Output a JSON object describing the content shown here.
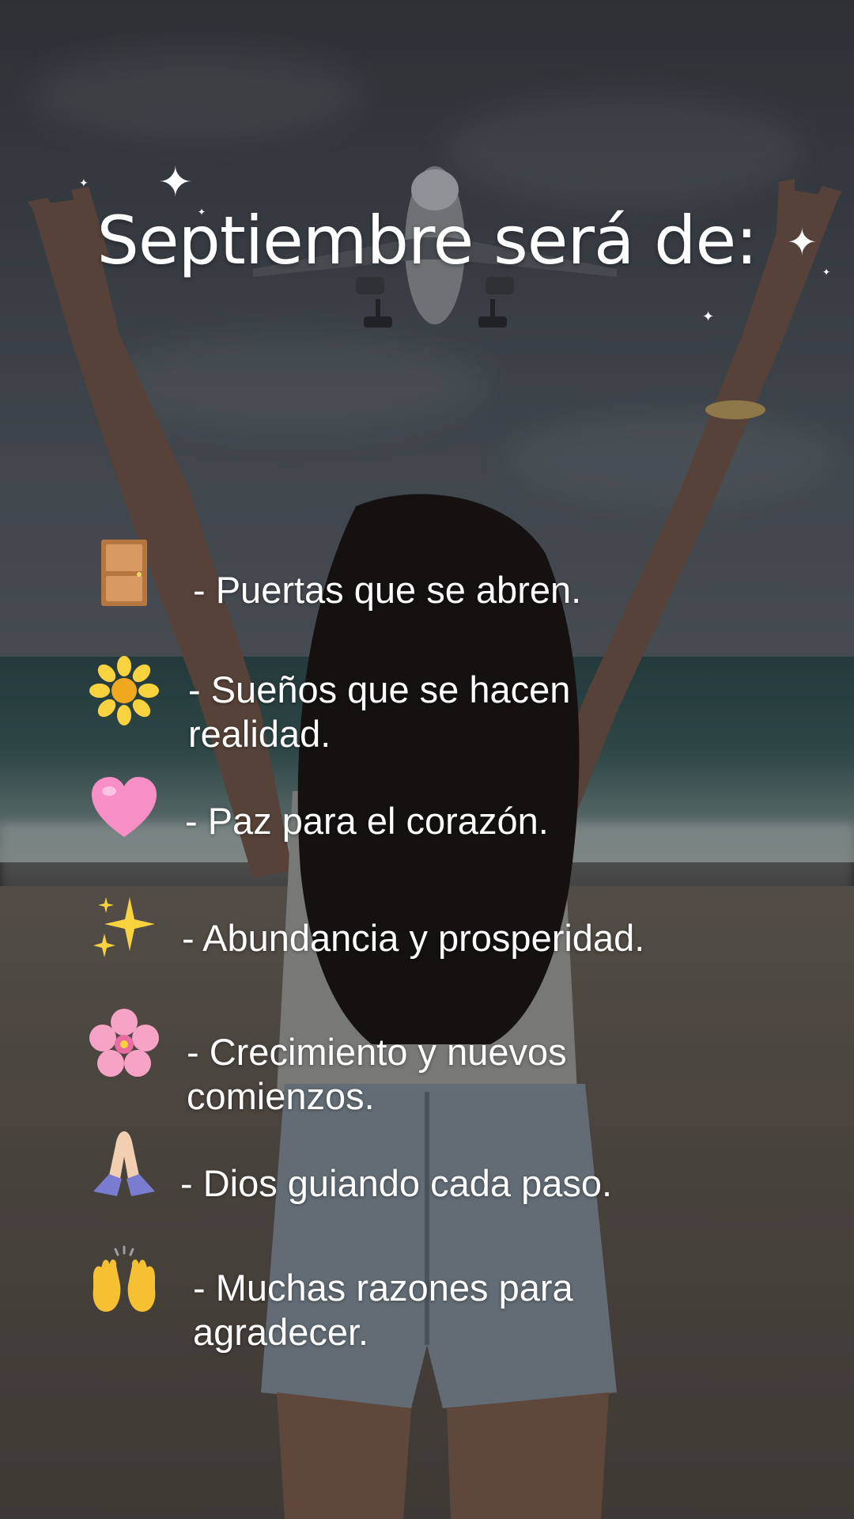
{
  "title": "Septiembre será de:",
  "items": [
    {
      "icon": "door-icon",
      "text": "- Puertas que se abren."
    },
    {
      "icon": "sunflower-icon",
      "text": "- Sueños que se hacen realidad."
    },
    {
      "icon": "pink-heart-icon",
      "text": "- Paz para el corazón."
    },
    {
      "icon": "sparkles-icon",
      "text": "- Abundancia y prosperidad."
    },
    {
      "icon": "cherry-blossom-icon",
      "text": "- Crecimiento y nuevos comienzos."
    },
    {
      "icon": "praying-hands-icon",
      "text": "- Dios guiando cada paso."
    },
    {
      "icon": "raising-hands-icon",
      "text": "- Muchas razones para agradecer."
    }
  ],
  "colors": {
    "text": "#ffffff",
    "heart": "#f78fc6",
    "flower": "#f9d33f",
    "door": "#c98a52",
    "blossom": "#f6a3c6"
  }
}
